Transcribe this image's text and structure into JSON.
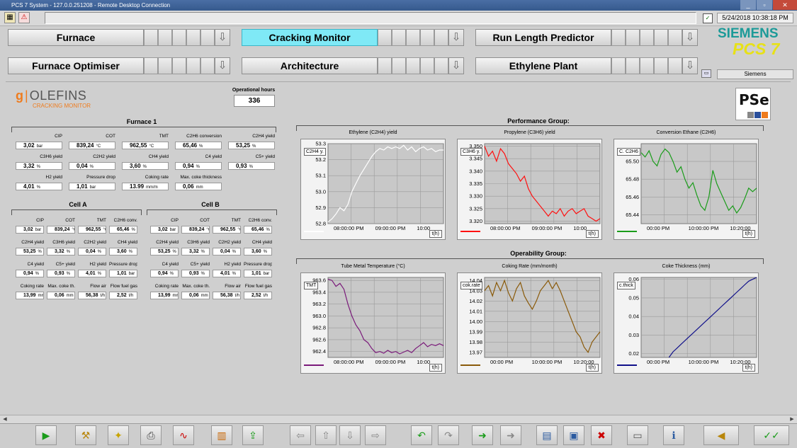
{
  "window": {
    "title": "PCS 7 System - 127.0.0.251208 - Remote Desktop Connection",
    "buttons": [
      "_",
      "▫",
      "✕"
    ]
  },
  "top": {
    "datetime": "5/24/2018 10:38:18 PM",
    "user": "Siemens",
    "cal_glyph": "✓",
    "monitor_glyph": "▭"
  },
  "brand": {
    "siemens": "SIEMENS",
    "pcs7": "PCS 7"
  },
  "nav": {
    "row1": [
      "Furnace",
      "Cracking Monitor",
      "Run Length Predictor"
    ],
    "row2": [
      "Furnace Optimiser",
      "Architecture",
      "Ethylene Plant"
    ],
    "active": "Cracking Monitor",
    "arrow_glyph": "⇩"
  },
  "logo": {
    "g": "g",
    "name": "OLEFINS",
    "sub": "CRACKING MONITOR",
    "pse": "PSe"
  },
  "operational_hours": {
    "label": "Operational hours",
    "value": "336"
  },
  "furnace1": {
    "title": "Furnace 1",
    "kpis": [
      {
        "label": "CIP",
        "value": "3,02",
        "unit": "bar"
      },
      {
        "label": "COT",
        "value": "839,24",
        "unit": "°C"
      },
      {
        "label": "TMT",
        "value": "962,55",
        "unit": "°C"
      },
      {
        "label": "C2H6 conversion",
        "value": "65,46",
        "unit": "%"
      },
      {
        "label": "C2H4 yield",
        "value": "53,25",
        "unit": "%"
      },
      {
        "label": "C3H6 yield",
        "value": "3,32",
        "unit": "%"
      },
      {
        "label": "C2H2 yield",
        "value": "0,04",
        "unit": "%"
      },
      {
        "label": "CH4 yield",
        "value": "3,60",
        "unit": "%"
      },
      {
        "label": "C4 yield",
        "value": "0,94",
        "unit": "%"
      },
      {
        "label": "C5+ yield",
        "value": "0,93",
        "unit": "%"
      },
      {
        "label": "H2 yield",
        "value": "4,01",
        "unit": "%"
      },
      {
        "label": "Pressure drop",
        "value": "1,01",
        "unit": "bar"
      },
      {
        "label": "Coking rate",
        "value": "13.99",
        "unit": "mm/m"
      },
      {
        "label": "Max. coke thickness",
        "value": "0,06",
        "unit": "mm"
      }
    ]
  },
  "cells": [
    {
      "title": "Cell A",
      "kpis": [
        {
          "label": "CIP",
          "value": "3,02",
          "unit": "bar"
        },
        {
          "label": "COT",
          "value": "839,24",
          "unit": "°C"
        },
        {
          "label": "TMT",
          "value": "962,55",
          "unit": "°C"
        },
        {
          "label": "C2H6 conv.",
          "value": "65,46",
          "unit": "%"
        },
        {
          "label": "C2H4 yield",
          "value": "53,25",
          "unit": "%"
        },
        {
          "label": "C3H6 yield",
          "value": "3,32",
          "unit": "%"
        },
        {
          "label": "C2H2 yield",
          "value": "0,04",
          "unit": "%"
        },
        {
          "label": "CH4 yield",
          "value": "3,60",
          "unit": "%"
        },
        {
          "label": "C4 yield",
          "value": "0,94",
          "unit": "%"
        },
        {
          "label": "C5+ yield",
          "value": "0,93",
          "unit": "%"
        },
        {
          "label": "H2 yield",
          "value": "4,01",
          "unit": "%"
        },
        {
          "label": "Pressure drop",
          "value": "1,01",
          "unit": "bar"
        },
        {
          "label": "Coking rate",
          "value": "13,99",
          "unit": "mm/m"
        },
        {
          "label": "Max. coke th.",
          "value": "0,06",
          "unit": "mm"
        },
        {
          "label": "Flow air",
          "value": "56,38",
          "unit": "t/h"
        },
        {
          "label": "Flow fuel gas",
          "value": "2,52",
          "unit": "t/h"
        }
      ]
    },
    {
      "title": "Cell B",
      "kpis": [
        {
          "label": "CIP",
          "value": "3,02",
          "unit": "bar"
        },
        {
          "label": "COT",
          "value": "839,24",
          "unit": "°C"
        },
        {
          "label": "TMT",
          "value": "962,55",
          "unit": "°C"
        },
        {
          "label": "C2H6 conv.",
          "value": "65,46",
          "unit": "%"
        },
        {
          "label": "C2H4 yield",
          "value": "53,25",
          "unit": "%"
        },
        {
          "label": "C3H6 yield",
          "value": "3,32",
          "unit": "%"
        },
        {
          "label": "C2H2 yield",
          "value": "0,04",
          "unit": "%"
        },
        {
          "label": "CH4 yield",
          "value": "3,60",
          "unit": "%"
        },
        {
          "label": "C4 yield",
          "value": "0,94",
          "unit": "%"
        },
        {
          "label": "C5+ yield",
          "value": "0,93",
          "unit": "%"
        },
        {
          "label": "H2 yield",
          "value": "4,01",
          "unit": "%"
        },
        {
          "label": "Pressure drop",
          "value": "1,01",
          "unit": "bar"
        },
        {
          "label": "Coking rate",
          "value": "13,99",
          "unit": "mm/m"
        },
        {
          "label": "Max. coke th.",
          "value": "0,06",
          "unit": "mm"
        },
        {
          "label": "Flow air",
          "value": "56,38",
          "unit": "t/h"
        },
        {
          "label": "Flow fuel gas",
          "value": "2,52",
          "unit": "t/h"
        }
      ]
    }
  ],
  "groups": {
    "performance": "Performance Group:",
    "operability": "Operability Group:"
  },
  "chart_data": [
    {
      "type": "line",
      "title": "Ethylene (C2H4) yield",
      "tag": "C2H4 y.",
      "xlabel": "t(h)",
      "color": "#ffffff",
      "x_ticks": [
        "08:00:00 PM",
        "09:00:00 PM",
        "10:00"
      ],
      "y_ticks": [
        "53.3",
        "53.2",
        "53.1",
        "53.0",
        "52.9",
        "52.8"
      ],
      "ylim": [
        52.8,
        53.3
      ],
      "series": [
        {
          "values": [
            52.81,
            52.83,
            52.86,
            52.9,
            52.88,
            52.92,
            53.0,
            53.05,
            53.1,
            53.14,
            53.18,
            53.22,
            53.25,
            53.27,
            53.26,
            53.28,
            53.27,
            53.28,
            53.27,
            53.29,
            53.26,
            53.28,
            53.25,
            53.27,
            53.28,
            53.26,
            53.27,
            53.25,
            53.26,
            53.26
          ]
        }
      ]
    },
    {
      "type": "line",
      "title": "Propylene (C3H6) yield",
      "tag": "C3H6 y.",
      "xlabel": "t(h)",
      "color": "#ff1010",
      "x_ticks": [
        "08:00:00 PM",
        "09:00:00 PM",
        "10:00"
      ],
      "y_ticks": [
        "3.350",
        "3.345",
        "3.340",
        "3.335",
        "3.330",
        "3.325",
        "3.320"
      ],
      "ylim": [
        3.319,
        3.351
      ],
      "series": [
        {
          "values": [
            3.35,
            3.346,
            3.348,
            3.344,
            3.349,
            3.347,
            3.343,
            3.341,
            3.339,
            3.336,
            3.338,
            3.333,
            3.33,
            3.328,
            3.326,
            3.324,
            3.322,
            3.324,
            3.323,
            3.325,
            3.322,
            3.324,
            3.325,
            3.323,
            3.324,
            3.325,
            3.322,
            3.321,
            3.32,
            3.321
          ]
        }
      ]
    },
    {
      "type": "line",
      "title": "Conversion Ethane (C2H6)",
      "tag": "C. C2H6",
      "xlabel": "t(h)",
      "color": "#1a9c1a",
      "x_ticks": [
        "00:00 PM",
        "10:00:00 PM",
        "10:20:00"
      ],
      "y_ticks": [
        "65.50",
        "65.48",
        "65.46",
        "65.44"
      ],
      "ylim": [
        65.43,
        65.52
      ],
      "series": [
        {
          "values": [
            65.51,
            65.505,
            65.512,
            65.5,
            65.495,
            65.508,
            65.514,
            65.51,
            65.5,
            65.488,
            65.494,
            65.48,
            65.47,
            65.476,
            65.462,
            65.45,
            65.445,
            65.46,
            65.49,
            65.475,
            65.465,
            65.455,
            65.445,
            65.45,
            65.442,
            65.448,
            65.458,
            65.47,
            65.466,
            65.47
          ]
        }
      ]
    },
    {
      "type": "line",
      "title": "Tube Metal Temperature (°C)",
      "tag": "TMT",
      "xlabel": "t(h)",
      "color": "#7a1a7a",
      "x_ticks": [
        "08:00:00 PM",
        "09:00:00 PM",
        "10:00"
      ],
      "y_ticks": [
        "963.6",
        "963.4",
        "963.2",
        "963.0",
        "962.8",
        "962.6",
        "962.4"
      ],
      "ylim": [
        962.3,
        963.65
      ],
      "series": [
        {
          "values": [
            963.62,
            963.6,
            963.5,
            963.55,
            963.45,
            963.2,
            963.0,
            962.85,
            962.75,
            962.6,
            962.55,
            962.45,
            962.38,
            962.4,
            962.37,
            962.42,
            962.38,
            962.4,
            962.36,
            962.39,
            962.42,
            962.38,
            962.45,
            962.5,
            962.55,
            962.48,
            962.52,
            962.5,
            962.53,
            962.5
          ]
        }
      ]
    },
    {
      "type": "line",
      "title": "Coking Rate (mm/month)",
      "tag": "cok.rate",
      "xlabel": "t(h)",
      "color": "#8a5a0a",
      "x_ticks": [
        "00:00 PM",
        "10:00:00 PM",
        "10:20:00"
      ],
      "y_ticks": [
        "14.04",
        "14.03",
        "14.02",
        "14.01",
        "14.00",
        "13.99",
        "13.98",
        "13.97"
      ],
      "ylim": [
        13.965,
        14.043
      ],
      "series": [
        {
          "values": [
            14.03,
            14.035,
            14.025,
            14.038,
            14.03,
            14.04,
            14.028,
            14.02,
            14.032,
            14.038,
            14.025,
            14.018,
            14.012,
            14.02,
            14.03,
            14.035,
            14.04,
            14.032,
            14.038,
            14.03,
            14.02,
            14.01,
            14.0,
            13.99,
            13.985,
            13.975,
            13.97,
            13.98,
            13.985,
            13.99
          ]
        }
      ]
    },
    {
      "type": "line",
      "title": "Coke Thickness (mm)",
      "tag": "c.thick",
      "xlabel": "t(h)",
      "color": "#10108a",
      "x_ticks": [
        "00:00 PM",
        "10:00:00 PM",
        "10:20:00"
      ],
      "y_ticks": [
        "0.06",
        "0.05",
        "0.04",
        "0.03",
        "0.02"
      ],
      "ylim": [
        0.018,
        0.061
      ],
      "series": [
        {
          "values": [
            null,
            null,
            null,
            null,
            null,
            null,
            null,
            0.018,
            0.021,
            0.023,
            0.025,
            0.027,
            0.029,
            0.031,
            0.033,
            0.035,
            0.037,
            0.039,
            0.041,
            0.043,
            0.045,
            0.047,
            0.049,
            0.051,
            0.053,
            0.055,
            0.057,
            0.059,
            0.06,
            0.061
          ]
        }
      ]
    }
  ],
  "toolbar": [
    {
      "name": "start-icon",
      "glyph": "▶",
      "color": "#1a9c1a"
    },
    {
      "name": "tools-icon",
      "glyph": "⚒",
      "color": "#b8860b"
    },
    {
      "name": "new-folder-icon",
      "glyph": "✦",
      "color": "#c8a400"
    },
    {
      "name": "print-icon",
      "glyph": "⎙",
      "color": "#444"
    },
    {
      "name": "trend-icon",
      "glyph": "∿",
      "color": "#c00"
    },
    {
      "name": "level-icon",
      "glyph": "▥",
      "color": "#c86400"
    },
    {
      "name": "export-icon",
      "glyph": "⇪",
      "color": "#1a9c1a"
    },
    {
      "name": "arrow-left-icon",
      "glyph": "⇦",
      "color": "#888"
    },
    {
      "name": "arrow-up-icon",
      "glyph": "⇧",
      "color": "#888"
    },
    {
      "name": "arrow-down-icon",
      "glyph": "⇩",
      "color": "#888"
    },
    {
      "name": "arrow-right-icon",
      "glyph": "⇨",
      "color": "#888"
    },
    {
      "name": "undo-icon",
      "glyph": "↶",
      "color": "#1a9c1a"
    },
    {
      "name": "redo-icon",
      "glyph": "↷",
      "color": "#888"
    },
    {
      "name": "forward-icon",
      "glyph": "➜",
      "color": "#1a9c1a"
    },
    {
      "name": "back-icon",
      "glyph": "➜",
      "color": "#888"
    },
    {
      "name": "open-icon",
      "glyph": "▤",
      "color": "#2a5aa0"
    },
    {
      "name": "save-icon",
      "glyph": "▣",
      "color": "#2a5aa0"
    },
    {
      "name": "delete-icon",
      "glyph": "✖",
      "color": "#c00"
    },
    {
      "name": "monitor-icon",
      "glyph": "▭",
      "color": "#555"
    },
    {
      "name": "info-icon",
      "glyph": "ℹ",
      "color": "#2a5aa0"
    },
    {
      "name": "horn-icon",
      "glyph": "◀",
      "color": "#b8860b"
    },
    {
      "name": "acknowledge-icon",
      "glyph": "✓✓",
      "color": "#1a9c1a"
    }
  ]
}
